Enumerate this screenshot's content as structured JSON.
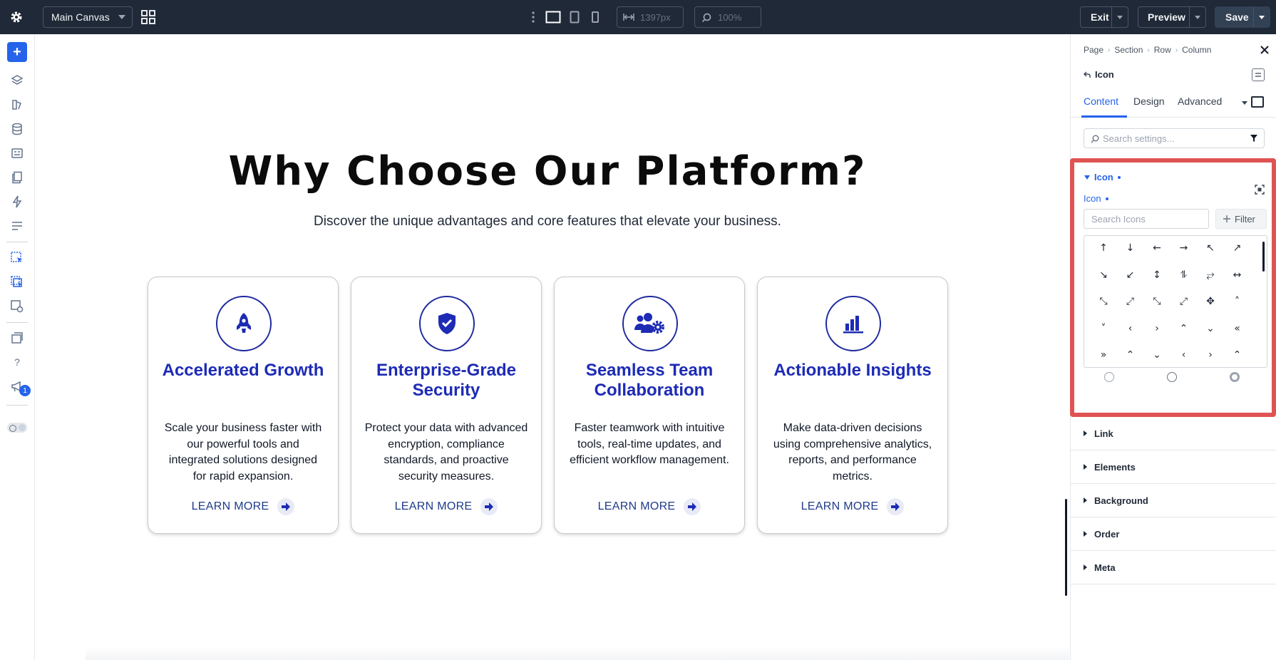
{
  "topbar": {
    "canvas_select": "Main Canvas",
    "width_value": "1397px",
    "zoom_value": "100%",
    "exit_label": "Exit",
    "preview_label": "Preview",
    "save_label": "Save"
  },
  "leftbar": {
    "add_label": "+",
    "help_label": "?",
    "notification_count": "1"
  },
  "canvas": {
    "headline": "Why Choose Our Platform?",
    "subline": "Discover the unique advantages and core features that elevate your business.",
    "cards": [
      {
        "icon": "rocket-icon",
        "title": "Accelerated Growth",
        "description": "Scale your business faster with our powerful tools and integrated solutions designed for rapid expansion.",
        "link": "LEARN MORE"
      },
      {
        "icon": "shield-check-icon",
        "title": "Enterprise-Grade Security",
        "description": "Protect your data with advanced encryption, compliance standards, and proactive security measures.",
        "link": "LEARN MORE"
      },
      {
        "icon": "team-gear-icon",
        "title": "Seamless Team Collaboration",
        "description": "Faster teamwork with intuitive tools, real-time updates, and efficient workflow management.",
        "link": "LEARN MORE"
      },
      {
        "icon": "bar-chart-icon",
        "title": "Actionable Insights",
        "description": "Make data-driven decisions using comprehensive analytics, reports, and performance metrics.",
        "link": "LEARN MORE"
      }
    ]
  },
  "panel": {
    "breadcrumb": [
      "Page",
      "Section",
      "Row",
      "Column"
    ],
    "module_name": "Icon",
    "tabs": [
      "Content",
      "Design",
      "Advanced"
    ],
    "search_placeholder": "Search settings...",
    "icon_section": {
      "heading": "Icon",
      "field_label": "Icon",
      "search_placeholder": "Search Icons",
      "filter_label": "Filter",
      "icons": [
        "↑",
        "↓",
        "←",
        "→",
        "↖",
        "↗",
        "↘",
        "↙",
        "↕",
        "⥮",
        "⥂",
        "↔",
        "⤡",
        "⤢",
        "⤡",
        "⤢",
        "✥",
        "˄",
        "˅",
        "‹",
        "›",
        "⌃",
        "⌄",
        "«",
        "»",
        "⌃",
        "⌄",
        "‹",
        "›",
        "⌃"
      ]
    },
    "sections": [
      "Link",
      "Elements",
      "Background",
      "Order",
      "Meta"
    ]
  },
  "colors": {
    "accent": "#2563eb",
    "brand_blue": "#1d2bb5",
    "highlight": "#e05353",
    "topbar": "#1f2937"
  }
}
